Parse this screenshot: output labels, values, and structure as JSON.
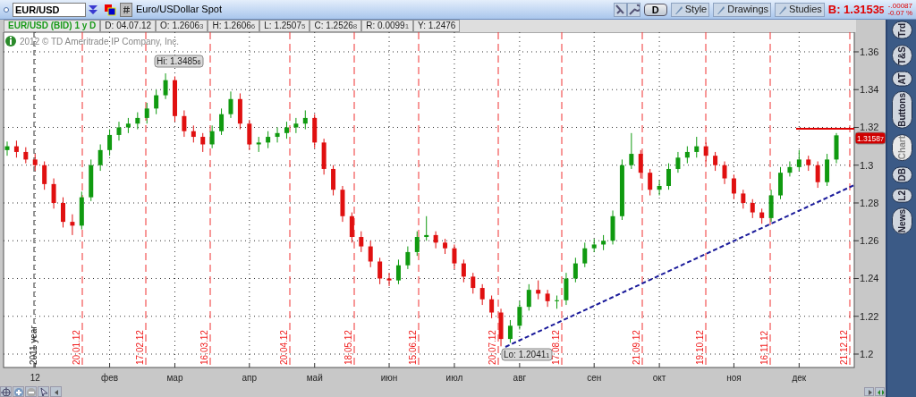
{
  "toolbar": {
    "symbol": "EUR/USD",
    "description": "Euro/USDollar Spot",
    "period_button": "D",
    "buttons": [
      "Style",
      "Drawings",
      "Studies"
    ],
    "bid": {
      "price": "B: 1.3153",
      "pip": "5"
    },
    "change": "-.00087",
    "change_percent": "-0.07 %"
  },
  "info_bar": {
    "title": "EUR/USD (BID) 1 y D",
    "cells": [
      {
        "text": "D: 04.07.12"
      },
      {
        "text": "O: 1.2606",
        "pip": "3"
      },
      {
        "text": "H: 1.2606",
        "pip": "6"
      },
      {
        "text": "L: 1.2507",
        "pip": "5"
      },
      {
        "text": "C: 1.2526",
        "pip": "8"
      },
      {
        "text": "R: 0.0099",
        "pip": "1"
      },
      {
        "text": "Y: 1.2476"
      }
    ]
  },
  "chart": {
    "copyright": "2012 © TD Ameritrade IP Company, Inc.",
    "year_marker": "2011 year",
    "date_lines": [
      "20.01.12",
      "17.02.12",
      "16.03.12",
      "20.04.12",
      "18.05.12",
      "15.06.12",
      "20.07.12",
      "17.08.12",
      "21.09.12",
      "19.10.12",
      "16.11.12",
      "21.12.12"
    ],
    "high_label": {
      "text": "Hi: 1.3485",
      "pip": "6"
    },
    "low_label": {
      "text": "Lo: 1.2041",
      "pip": "1"
    },
    "last_price": {
      "text": "1.3158",
      "pip": "7"
    },
    "chart_data": {
      "type": "candlestick",
      "categories": [
        null,
        null,
        null,
        "12",
        null,
        null,
        null,
        null,
        null,
        null,
        null,
        "фев",
        null,
        null,
        null,
        null,
        null,
        null,
        "мар",
        null,
        null,
        null,
        null,
        null,
        null,
        null,
        "апр",
        null,
        null,
        null,
        null,
        null,
        null,
        "май",
        null,
        null,
        null,
        null,
        null,
        null,
        null,
        "июн",
        null,
        null,
        null,
        null,
        null,
        null,
        "июл",
        null,
        null,
        null,
        null,
        null,
        null,
        "авг",
        null,
        null,
        null,
        null,
        null,
        null,
        null,
        "сен",
        null,
        null,
        null,
        null,
        null,
        null,
        "окт",
        null,
        null,
        null,
        null,
        null,
        null,
        null,
        "ноя",
        null,
        null,
        null,
        null,
        null,
        null,
        "дек",
        null,
        null,
        null,
        null
      ],
      "grid": true,
      "ylim": [
        1.1929,
        1.3704
      ],
      "yticks": [
        1.36,
        1.34,
        1.32,
        1.3,
        1.28,
        1.26,
        1.24,
        1.22,
        1.2
      ],
      "ohlc": [
        [
          1.308,
          1.3125,
          1.305,
          1.31
        ],
        [
          1.31,
          1.313,
          1.304,
          1.307
        ],
        [
          1.307,
          1.3095,
          1.301,
          1.303
        ],
        [
          1.303,
          1.306,
          1.297,
          1.3
        ],
        [
          1.3,
          1.302,
          1.287,
          1.29
        ],
        [
          1.29,
          1.293,
          1.277,
          1.28
        ],
        [
          1.28,
          1.283,
          1.267,
          1.27
        ],
        [
          1.27,
          1.274,
          1.263,
          1.268
        ],
        [
          1.268,
          1.286,
          1.266,
          1.283
        ],
        [
          1.283,
          1.303,
          1.281,
          1.3
        ],
        [
          1.3,
          1.311,
          1.297,
          1.308
        ],
        [
          1.308,
          1.319,
          1.305,
          1.316
        ],
        [
          1.316,
          1.323,
          1.313,
          1.32
        ],
        [
          1.32,
          1.325,
          1.317,
          1.322
        ],
        [
          1.322,
          1.328,
          1.319,
          1.325
        ],
        [
          1.325,
          1.333,
          1.322,
          1.33
        ],
        [
          1.33,
          1.34,
          1.327,
          1.337
        ],
        [
          1.337,
          1.3486,
          1.335,
          1.345
        ],
        [
          1.345,
          1.347,
          1.323,
          1.326
        ],
        [
          1.326,
          1.329,
          1.315,
          1.318
        ],
        [
          1.318,
          1.321,
          1.312,
          1.315
        ],
        [
          1.315,
          1.317,
          1.307,
          1.311
        ],
        [
          1.311,
          1.321,
          1.309,
          1.318
        ],
        [
          1.318,
          1.33,
          1.316,
          1.327
        ],
        [
          1.327,
          1.339,
          1.325,
          1.335
        ],
        [
          1.335,
          1.338,
          1.319,
          1.322
        ],
        [
          1.322,
          1.324,
          1.308,
          1.311
        ],
        [
          1.311,
          1.315,
          1.307,
          1.312
        ],
        [
          1.312,
          1.318,
          1.309,
          1.315
        ],
        [
          1.315,
          1.32,
          1.312,
          1.317
        ],
        [
          1.317,
          1.323,
          1.314,
          1.32
        ],
        [
          1.32,
          1.325,
          1.317,
          1.322
        ],
        [
          1.322,
          1.329,
          1.319,
          1.325
        ],
        [
          1.325,
          1.327,
          1.309,
          1.312
        ],
        [
          1.312,
          1.314,
          1.295,
          1.298
        ],
        [
          1.298,
          1.3,
          1.284,
          1.287
        ],
        [
          1.287,
          1.289,
          1.27,
          1.273
        ],
        [
          1.273,
          1.275,
          1.259,
          1.262
        ],
        [
          1.262,
          1.265,
          1.254,
          1.257
        ],
        [
          1.257,
          1.26,
          1.246,
          1.249
        ],
        [
          1.249,
          1.251,
          1.237,
          1.24
        ],
        [
          1.24,
          1.243,
          1.236,
          1.239
        ],
        [
          1.239,
          1.25,
          1.237,
          1.247
        ],
        [
          1.247,
          1.257,
          1.245,
          1.254
        ],
        [
          1.254,
          1.265,
          1.252,
          1.262
        ],
        [
          1.262,
          1.273,
          1.26,
          1.263
        ],
        [
          1.263,
          1.265,
          1.256,
          1.259
        ],
        [
          1.259,
          1.261,
          1.253,
          1.256
        ],
        [
          1.256,
          1.258,
          1.245,
          1.248
        ],
        [
          1.248,
          1.25,
          1.238,
          1.241
        ],
        [
          1.241,
          1.243,
          1.232,
          1.235
        ],
        [
          1.235,
          1.237,
          1.226,
          1.229
        ],
        [
          1.229,
          1.231,
          1.219,
          1.222
        ],
        [
          1.222,
          1.224,
          1.2041,
          1.208
        ],
        [
          1.208,
          1.218,
          1.206,
          1.215
        ],
        [
          1.215,
          1.228,
          1.213,
          1.225
        ],
        [
          1.225,
          1.237,
          1.223,
          1.234
        ],
        [
          1.234,
          1.239,
          1.229,
          1.232
        ],
        [
          1.232,
          1.234,
          1.225,
          1.228
        ],
        [
          1.228,
          1.231,
          1.224,
          1.2285
        ],
        [
          1.2285,
          1.243,
          1.226,
          1.24
        ],
        [
          1.24,
          1.251,
          1.238,
          1.248
        ],
        [
          1.248,
          1.259,
          1.246,
          1.256
        ],
        [
          1.256,
          1.261,
          1.254,
          1.258
        ],
        [
          1.258,
          1.263,
          1.255,
          1.26
        ],
        [
          1.26,
          1.276,
          1.258,
          1.273
        ],
        [
          1.273,
          1.303,
          1.271,
          1.3
        ],
        [
          1.3,
          1.317,
          1.298,
          1.306
        ],
        [
          1.306,
          1.308,
          1.293,
          1.296
        ],
        [
          1.296,
          1.298,
          1.284,
          1.287
        ],
        [
          1.287,
          1.292,
          1.284,
          1.289
        ],
        [
          1.289,
          1.301,
          1.287,
          1.298
        ],
        [
          1.298,
          1.307,
          1.296,
          1.304
        ],
        [
          1.304,
          1.31,
          1.301,
          1.307
        ],
        [
          1.307,
          1.315,
          1.304,
          1.31
        ],
        [
          1.31,
          1.312,
          1.302,
          1.305
        ],
        [
          1.305,
          1.307,
          1.297,
          1.3
        ],
        [
          1.3,
          1.302,
          1.29,
          1.293
        ],
        [
          1.293,
          1.295,
          1.282,
          1.285
        ],
        [
          1.285,
          1.287,
          1.277,
          1.28
        ],
        [
          1.28,
          1.282,
          1.272,
          1.275
        ],
        [
          1.275,
          1.277,
          1.269,
          1.272
        ],
        [
          1.272,
          1.287,
          1.27,
          1.284
        ],
        [
          1.284,
          1.299,
          1.282,
          1.296
        ],
        [
          1.296,
          1.302,
          1.294,
          1.299
        ],
        [
          1.299,
          1.308,
          1.297,
          1.303
        ],
        [
          1.303,
          1.305,
          1.297,
          1.3
        ],
        [
          1.3,
          1.302,
          1.288,
          1.291
        ],
        [
          1.291,
          1.306,
          1.289,
          1.303
        ],
        [
          1.303,
          1.317,
          1.301,
          1.3158
        ]
      ]
    }
  },
  "sidebar_tabs": [
    {
      "label": "Trd",
      "selected": false
    },
    {
      "label": "T&S",
      "selected": false
    },
    {
      "label": "AT",
      "selected": false
    },
    {
      "label": "Buttons",
      "selected": false
    },
    {
      "label": "Chart",
      "selected": true
    },
    {
      "label": "DB",
      "selected": false
    },
    {
      "label": "L2",
      "selected": false
    },
    {
      "label": "News",
      "selected": false
    }
  ]
}
